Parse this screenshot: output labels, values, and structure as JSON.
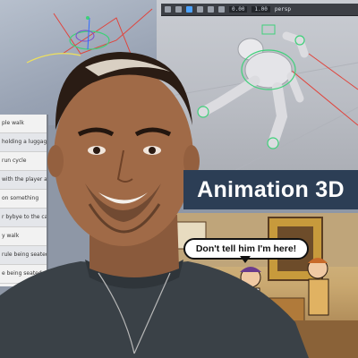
{
  "title_banner": {
    "text": "Animation 3D"
  },
  "speech_bubble": {
    "text": "Don't tell him I'm here!"
  },
  "toolbar": {
    "time_value": "0.00",
    "field_value": "1.00",
    "cam_label": "persp"
  },
  "anim_list": {
    "items": [
      "ple walk",
      "holding a luggage",
      "run cycle",
      "with the player an",
      "on something",
      "r bybye to the cam",
      "y walk",
      "rule being seated",
      "e being seated"
    ]
  },
  "colors": {
    "banner_bg": "#2c3e55",
    "rig_green": "#3fd07a",
    "rig_red": "#e0443c",
    "highlight_blue": "#4da3ff"
  },
  "icons": [
    "play-icon",
    "rig-controls-icon"
  ]
}
